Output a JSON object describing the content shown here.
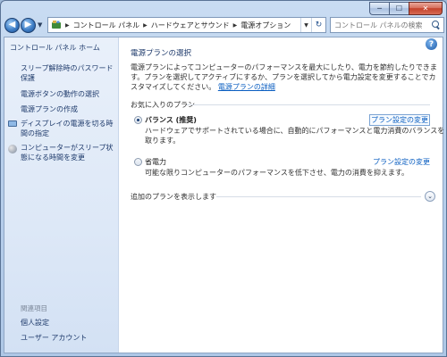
{
  "window": {
    "caption": {
      "minimize": "─",
      "maximize": "☐",
      "close": "✕"
    }
  },
  "nav": {
    "back": "◀",
    "forward": "▶",
    "breadcrumbs": [
      "コントロール パネル",
      "ハードウェアとサウンド",
      "電源オプション"
    ],
    "search_placeholder": "コントロール パネルの検索"
  },
  "sidebar": {
    "home": "コントロール パネル ホーム",
    "links": [
      "スリープ解除時のパスワード保護",
      "電源ボタンの動作の選択",
      "電源プランの作成",
      "ディスプレイの電源を切る時間の指定",
      "コンピューターがスリープ状態になる時間を変更"
    ],
    "related_heading": "関連項目",
    "related_links": [
      "個人設定",
      "ユーザー アカウント"
    ]
  },
  "main": {
    "title": "電源プランの選択",
    "description": "電源プランによってコンピューターのパフォーマンスを最大にしたり、電力を節約したりできます。プランを選択してアクティブにするか、プランを選択してから電力設定を変更することでカスタマイズしてください。",
    "description_link": "電源プランの詳細",
    "favorites_label": "お気に入りのプラン",
    "plans": [
      {
        "name": "バランス (推奨)",
        "selected": true,
        "description": "ハードウェアでサポートされている場合に、自動的にパフォーマンスと電力消費のバランスを取ります。",
        "link": "プラン設定の変更"
      },
      {
        "name": "省電力",
        "selected": false,
        "description": "可能な限りコンピューターのパフォーマンスを低下させ、電力の消費を抑えます。",
        "link": "プラン設定の変更"
      }
    ],
    "more_plans": "追加のプランを表示します",
    "help": "?"
  }
}
